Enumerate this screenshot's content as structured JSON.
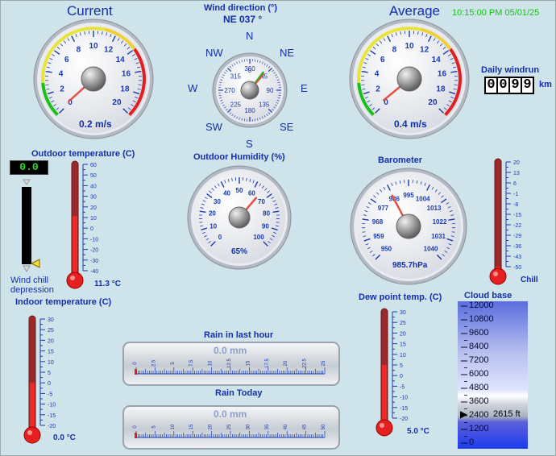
{
  "timestamp": "10:15:00 PM 05/01/25",
  "wind_current": {
    "title": "Current",
    "value": "0.2 m/s",
    "ticks": [
      "0",
      "2",
      "4",
      "6",
      "8",
      "10",
      "12",
      "14",
      "16",
      "18",
      "20"
    ],
    "reading": 0.2
  },
  "wind_average": {
    "title": "Average",
    "value": "0.4 m/s",
    "ticks": [
      "0",
      "2",
      "4",
      "6",
      "8",
      "10",
      "12",
      "14",
      "16",
      "18",
      "20"
    ],
    "reading": 0.4
  },
  "wind_direction": {
    "title": "Wind direction (°)",
    "value": "NE  037 °",
    "compass": [
      "N",
      "NE",
      "E",
      "SE",
      "S",
      "SW",
      "W",
      "NW"
    ],
    "dial_ticks": [
      "0",
      "45",
      "90",
      "135",
      "180",
      "225",
      "270",
      "315",
      "360"
    ],
    "reading": 37
  },
  "daily_windrun": {
    "title": "Daily windrun",
    "digits": [
      "0",
      "0",
      "9",
      "9"
    ],
    "unit": "km"
  },
  "outdoor_temperature": {
    "title": "Outdoor temperature (C)",
    "value": "11.3 °C",
    "ticks": [
      "60",
      "50",
      "40",
      "30",
      "20",
      "10",
      "0",
      "-10",
      "-20",
      "-30",
      "-40"
    ],
    "reading": 11.3,
    "min": -40,
    "max": 60
  },
  "wind_chill": {
    "lcd": "0.0",
    "label_line1": "Wind chill",
    "label_line2": "depression",
    "reading": 0.0
  },
  "outdoor_humidity": {
    "title": "Outdoor Humidity (%)",
    "value": "65%",
    "ticks": [
      "0",
      "10",
      "20",
      "30",
      "40",
      "50",
      "60",
      "70",
      "80",
      "90",
      "100"
    ],
    "reading": 65
  },
  "barometer": {
    "title": "Barometer",
    "value": "985.7hPa",
    "ticks": [
      "950",
      "959",
      "968",
      "977",
      "986",
      "995",
      "1004",
      "1013",
      "1022",
      "1031",
      "1040"
    ],
    "reading": 985.7
  },
  "chill": {
    "label": "Chill",
    "ticks": [
      "20",
      "13",
      "6",
      "-1",
      "-8",
      "-15",
      "-22",
      "-29",
      "-36",
      "-43",
      "-50"
    ],
    "reading": -50,
    "min": -50,
    "max": 20
  },
  "indoor_temperature": {
    "title": "Indoor temperature (C)",
    "value": "0.0 °C",
    "ticks": [
      "30",
      "25",
      "20",
      "15",
      "10",
      "5",
      "0",
      "-5",
      "-10",
      "-15",
      "-20"
    ],
    "reading": 0.0,
    "min": -20,
    "max": 30
  },
  "dew_point": {
    "title": "Dew point temp. (C)",
    "value": "5.0 °C",
    "ticks": [
      "30",
      "25",
      "20",
      "15",
      "10",
      "5",
      "0",
      "-5",
      "-10",
      "-15",
      "-20"
    ],
    "reading": 5.0,
    "min": -20,
    "max": 30
  },
  "rain_last_hour": {
    "title": "Rain in last hour",
    "value": "0.0 mm",
    "ticks": [
      "0",
      "2.5",
      "5",
      "7.5",
      "10",
      "12.5",
      "15",
      "17.5",
      "20",
      "22.5",
      "25"
    ]
  },
  "rain_today": {
    "title": "Rain Today",
    "value": "0.0 mm",
    "ticks": [
      "0",
      "5",
      "10",
      "15",
      "20",
      "25",
      "30",
      "35",
      "40",
      "45",
      "50"
    ]
  },
  "cloud_base": {
    "title": "Cloud base",
    "ticks": [
      "12000",
      "10800",
      "9600",
      "8400",
      "7200",
      "6000",
      "4800",
      "3600",
      "2400",
      "1200",
      "0"
    ],
    "value": "2615 ft",
    "reading": 2615
  }
}
